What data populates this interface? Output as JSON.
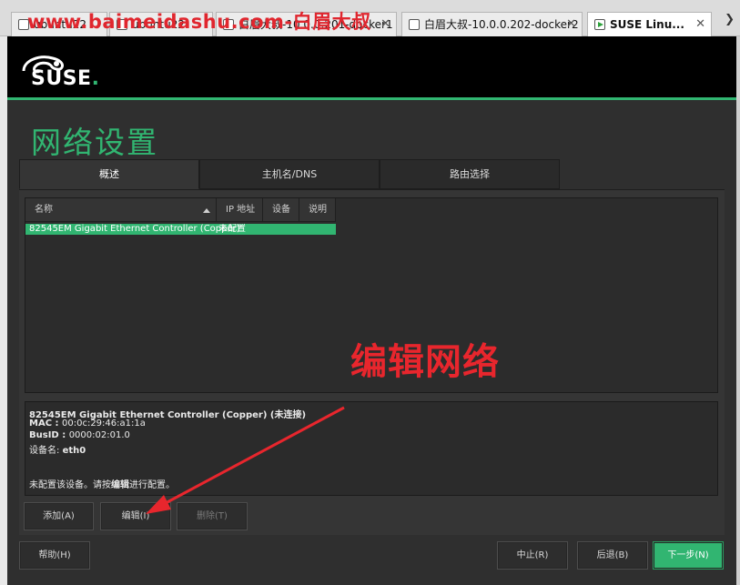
{
  "watermark": "www.baimeidashu.com-白眉大叔",
  "browser_tabs": [
    {
      "label": "ubuntu22",
      "active": false
    },
    {
      "label": "ubuntu22",
      "active": false
    },
    {
      "label": "白眉大叔-10.0.0.201-docker1",
      "active": false
    },
    {
      "label": "白眉大叔-10.0.0.202-docker2",
      "active": false
    },
    {
      "label": "SUSE Linu...",
      "active": true
    }
  ],
  "vm": {
    "logo": {
      "text": "SUSE",
      "dot": "."
    },
    "title": "网络设置",
    "tabs": [
      {
        "label": "概述",
        "active": true
      },
      {
        "label": "主机名/DNS",
        "active": false
      },
      {
        "label": "路由选择",
        "active": false
      }
    ],
    "table": {
      "columns": [
        "名称",
        "IP 地址",
        "设备",
        "说明"
      ],
      "rows": [
        {
          "name": "82545EM Gigabit Ethernet Controller (Copper)",
          "ip": "未配置",
          "device": "",
          "desc": ""
        }
      ]
    },
    "annotation": "编辑网络",
    "details": {
      "title": "82545EM Gigabit Ethernet Controller (Copper)",
      "status": " (未连接)",
      "mac_label": "MAC : ",
      "mac": "00:0c:29:46:a1:1a",
      "busid_label": "BusID : ",
      "busid": "0000:02:01.0",
      "dev_label": "设备名: ",
      "dev": "eth0",
      "note_pre": "未配置该设备。请按",
      "note_bold": "编辑",
      "note_post": "进行配置。"
    },
    "buttons": {
      "add": "添加(A)",
      "edit": "编辑(I)",
      "delete": "删除(T)",
      "help": "帮助(H)",
      "abort": "中止(R)",
      "back": "后退(B)",
      "next": "下一步(N)"
    }
  },
  "colors": {
    "accent": "#31b571",
    "annotation": "#e8262d",
    "panel": "#353535"
  }
}
